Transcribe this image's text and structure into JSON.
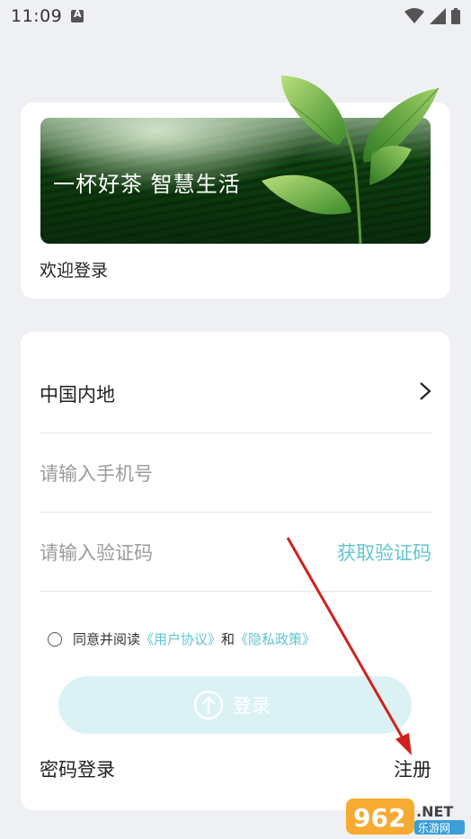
{
  "status_bar": {
    "time": "11:09",
    "icons": [
      "notification-a-icon",
      "wifi-icon",
      "signal-icon",
      "battery-icon"
    ]
  },
  "banner": {
    "slogan": "一杯好茶 智慧生活"
  },
  "welcome_text": "欢迎登录",
  "form": {
    "region": "中国内地",
    "phone_placeholder": "请输入手机号",
    "code_placeholder": "请输入验证码",
    "get_code_label": "获取验证码"
  },
  "agreement": {
    "prefix": "同意并阅读",
    "user_agreement": "《用户协议》",
    "and": "和",
    "privacy_policy": "《隐私政策》"
  },
  "login_button": "登录",
  "password_login": "密码登录",
  "register": "注册",
  "watermark": {
    "number": "962",
    "domain": ".NET",
    "sub": "乐游网"
  },
  "colors": {
    "accent": "#63c5cf",
    "login_button_bg": "#dbf2f5",
    "page_bg": "#eef0f4",
    "annotation_arrow": "#d0211c"
  }
}
